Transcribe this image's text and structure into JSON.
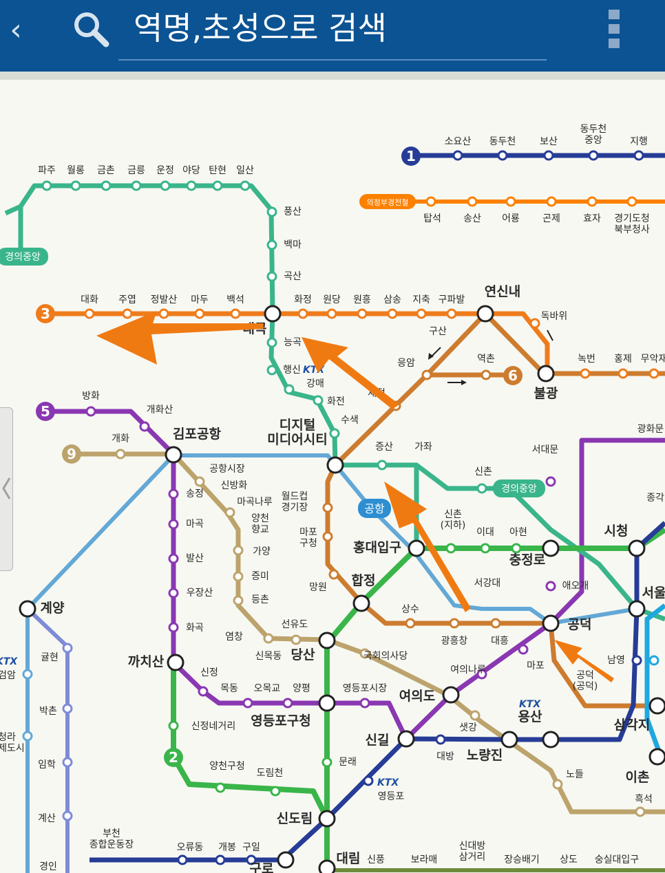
{
  "appbar": {
    "back_icon": "chevron-left-icon",
    "search_icon": "magnifier-icon",
    "search_placeholder": "역명,초성으로 검색",
    "menu_icon": "vertical-dots-icon",
    "color": "#0b5393"
  },
  "map": {
    "line_badges": [
      "1",
      "3",
      "5",
      "6",
      "9",
      "2"
    ],
    "line_labels": {
      "uijeongbu": "의정부경전철",
      "gyeongui_left": "경의중앙",
      "gyeongui_mid": "경의중앙",
      "airport": "공항"
    },
    "ktx_labels": [
      "KTX",
      "KTX",
      "KTX",
      "KTX"
    ],
    "stations": [
      "소요산",
      "동두천",
      "보산",
      "동두천\n중앙",
      "지행",
      "탑석",
      "송산",
      "어룡",
      "곤제",
      "효자",
      "경기도청\n북부청사",
      "파주",
      "월롱",
      "금촌",
      "금릉",
      "운정",
      "야당",
      "탄현",
      "일산",
      "풍산",
      "백마",
      "곡산",
      "대화",
      "주엽",
      "정발산",
      "마두",
      "백석",
      "대곡",
      "화정",
      "원당",
      "원흥",
      "삼송",
      "지축",
      "구파발",
      "연신내",
      "구산",
      "독바위",
      "응암",
      "역촌",
      "불광",
      "녹번",
      "홍제",
      "무악재",
      "능곡",
      "행신",
      "강매",
      "화전",
      "수색",
      "새절",
      "방화",
      "개화산",
      "김포공항",
      "개화",
      "디지털\n미디어시티",
      "증산",
      "가좌",
      "신촌",
      "광화문",
      "서대문",
      "공항시장",
      "신방화",
      "송정",
      "마곡나루",
      "양천\n향교",
      "마곡",
      "가양",
      "증미",
      "발산",
      "등촌",
      "월드컵\n경기장",
      "마포\n구청",
      "망원",
      "합정",
      "신촌\n(지하)",
      "이대",
      "아현",
      "충정로",
      "시청",
      "홍대입구",
      "서강대",
      "애오개",
      "서울",
      "공덕",
      "상수",
      "광흥창",
      "대흥",
      "우장산",
      "화곡",
      "염창",
      "선유도",
      "신목동",
      "당산",
      "까치산",
      "신정",
      "목동",
      "오목교",
      "양평",
      "국회의사당",
      "여의나루",
      "마포",
      "공덕\n(공덕)",
      "남영",
      "영등포시장",
      "여의도",
      "샛강",
      "용산",
      "삼각지",
      "영등포구청",
      "신길",
      "대방",
      "노량진",
      "이촌",
      "신정네거리",
      "양천구청",
      "도림천",
      "문래",
      "영등포",
      "노들",
      "흑석",
      "계양",
      "귤현",
      "박촌",
      "임학",
      "계산",
      "검암",
      "청라\n국제도시",
      "부천\n종합운동장",
      "오류동",
      "개봉",
      "구일",
      "구로",
      "신도림",
      "대림",
      "신풍",
      "보라매",
      "신대방\n삼거리",
      "장승배기",
      "상도",
      "숭실대입구",
      "경인",
      "종각"
    ]
  }
}
